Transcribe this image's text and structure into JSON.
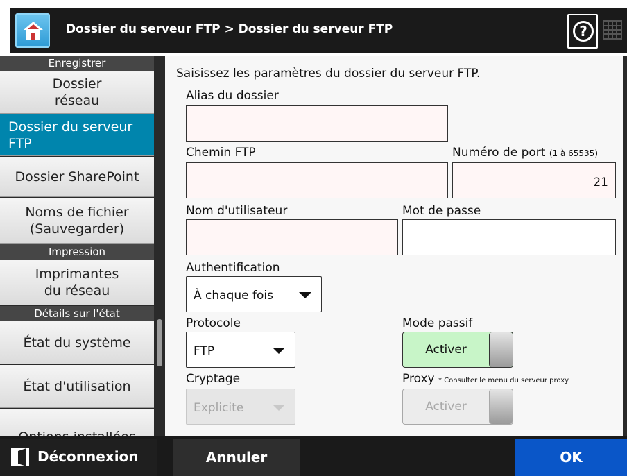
{
  "header": {
    "breadcrumb": "Dossier du serveur FTP > Dossier du serveur FTP",
    "help_symbol": "?",
    "home_icon": "home-icon",
    "help_icon": "help-icon",
    "grid_icon": "keyboard-grid-icon"
  },
  "sidebar": {
    "sections": [
      {
        "label": "Enregistrer"
      },
      {
        "label": "Impression"
      },
      {
        "label": "Détails sur l'état"
      }
    ],
    "items": [
      {
        "label": "Dossier réseau"
      },
      {
        "label": "Dossier du serveur FTP"
      },
      {
        "label": "Dossier SharePoint"
      },
      {
        "label": "Noms de fichier (Sauvegarder)"
      },
      {
        "label": "Imprimantes du réseau"
      },
      {
        "label": "État du système"
      },
      {
        "label": "État d'utilisation"
      },
      {
        "label": "Options installées"
      }
    ],
    "active_index": 1,
    "accent_color": "#0085ad"
  },
  "form": {
    "instructions": "Saisissez les paramètres du dossier du serveur FTP.",
    "alias": {
      "label": "Alias du dossier",
      "value": ""
    },
    "ftp_path": {
      "label": "Chemin FTP",
      "value": ""
    },
    "port": {
      "label": "Numéro de port",
      "hint": "(1 à 65535)",
      "value": "21"
    },
    "username": {
      "label": "Nom d'utilisateur",
      "value": ""
    },
    "password": {
      "label": "Mot de passe",
      "value": ""
    },
    "authentication": {
      "label": "Authentification",
      "value": "À chaque fois"
    },
    "protocol": {
      "label": "Protocole",
      "value": "FTP"
    },
    "passive_mode": {
      "label": "Mode passif",
      "value": "Activer",
      "enabled": true
    },
    "encryption": {
      "label": "Cryptage",
      "value": "Explicite",
      "disabled": true
    },
    "proxy": {
      "label": "Proxy",
      "note": "* Consulter le menu du serveur proxy",
      "value": "Activer",
      "disabled": true
    }
  },
  "footer": {
    "logout_label": "Déconnexion",
    "cancel_label": "Annuler",
    "ok_label": "OK",
    "logout_icon": "logout-icon",
    "ok_color": "#0a56c8"
  }
}
